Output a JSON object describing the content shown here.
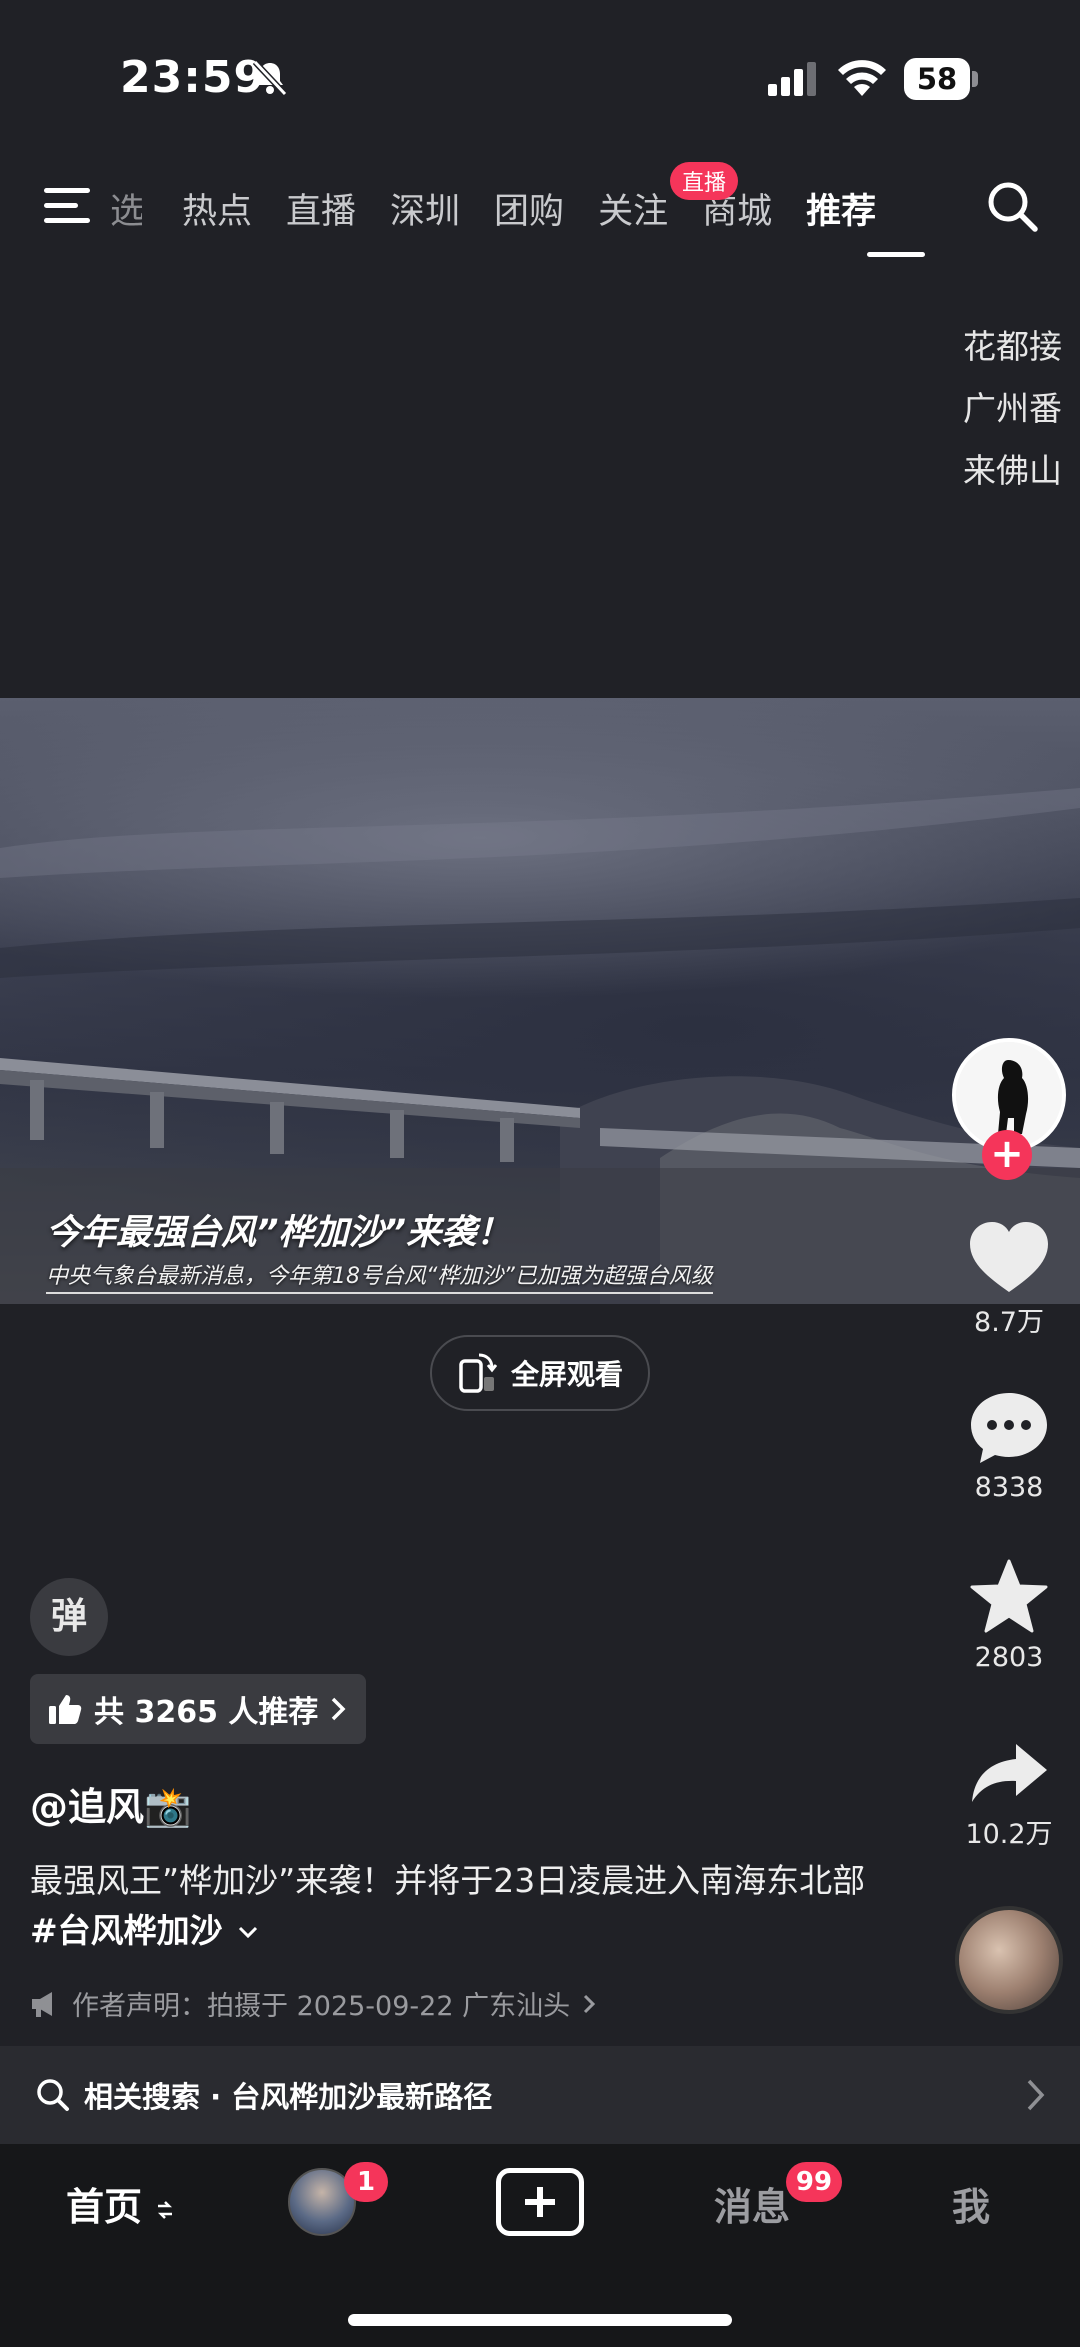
{
  "status_bar": {
    "time": "23:59",
    "battery": "58"
  },
  "top_nav": {
    "tabs": [
      "热点",
      "直播",
      "深圳",
      "团购",
      "关注",
      "商城",
      "推荐"
    ],
    "partial_tab": "选",
    "active_tab": "推荐",
    "live_badge": "直播"
  },
  "side_text": [
    "花都接",
    "广州番",
    "来佛山"
  ],
  "video": {
    "caption_title": "今年最强台风”桦加沙”来袭！",
    "caption_sub": "中央气象台最新消息，今年第18号台风“桦加沙”已加强为超强台风级",
    "fullscreen_label": "全屏观看"
  },
  "actions": {
    "likes": "8.7万",
    "comments": "8338",
    "favorites": "2803",
    "shares": "10.2万",
    "follow_plus": "+"
  },
  "info": {
    "danmu": "弹",
    "recommend": "共 3265 人推荐",
    "author": "@追风📸",
    "desc_text": "最强风王”桦加沙”来袭！并将于23日凌晨进入南海东北部 ",
    "desc_tag": "#台风桦加沙",
    "statement": "作者声明：拍摄于 2025-09-22 广东汕头",
    "related_prefix": "相关搜索 · ",
    "related_query": "台风桦加沙最新路径"
  },
  "bottom_nav": {
    "home": "首页",
    "friends_badge": "1",
    "messages": "消息",
    "messages_badge": "99",
    "me": "我"
  },
  "colors": {
    "accent": "#f5355a",
    "background": "#202126"
  }
}
